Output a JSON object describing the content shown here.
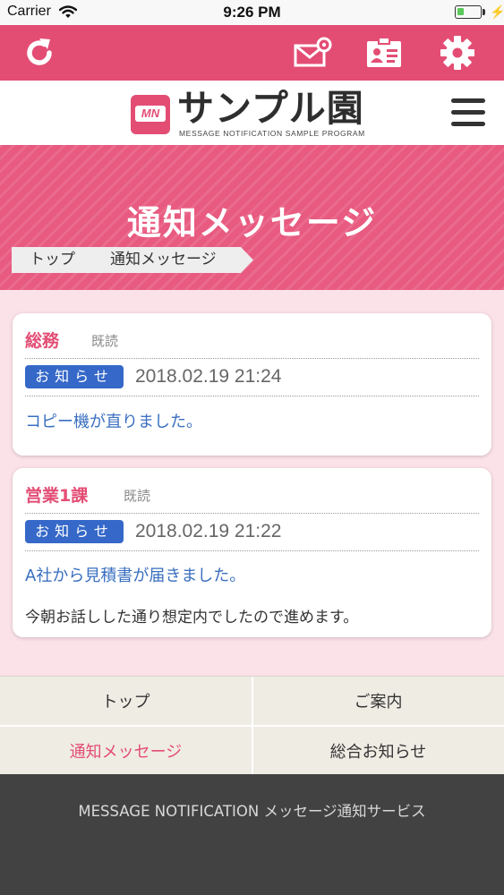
{
  "status_bar": {
    "carrier": "Carrier",
    "time": "9:26 PM",
    "battery_level": 0.3
  },
  "header": {
    "icons": [
      "refresh-icon",
      "mail-settings-icon",
      "id-card-icon",
      "gear-icon"
    ],
    "accent_color": "#e34d74"
  },
  "logo": {
    "mark": "MN",
    "title": "サンプル園",
    "subtitle": "MESSAGE NOTIFICATION SAMPLE PROGRAM"
  },
  "page": {
    "title": "通知メッセージ"
  },
  "breadcrumb": [
    "トップ",
    "通知メッセージ"
  ],
  "messages": [
    {
      "department": "総務",
      "status": "既読",
      "category": "お知らせ",
      "datetime": "2018.02.19 21:24",
      "subject": "コピー機が直りました。",
      "body": ""
    },
    {
      "department": "営業1課",
      "status": "既読",
      "category": "お知らせ",
      "datetime": "2018.02.19 21:22",
      "subject": "A社から見積書が届きました。",
      "body": "今朝お話しした通り想定内でしたので進めます。"
    }
  ],
  "bottom_menu": {
    "items": [
      "トップ",
      "ご案内",
      "通知メッセージ",
      "総合お知らせ"
    ],
    "active_index": 2
  },
  "footer": {
    "text": "MESSAGE NOTIFICATION  メッセージ通知サービス"
  }
}
